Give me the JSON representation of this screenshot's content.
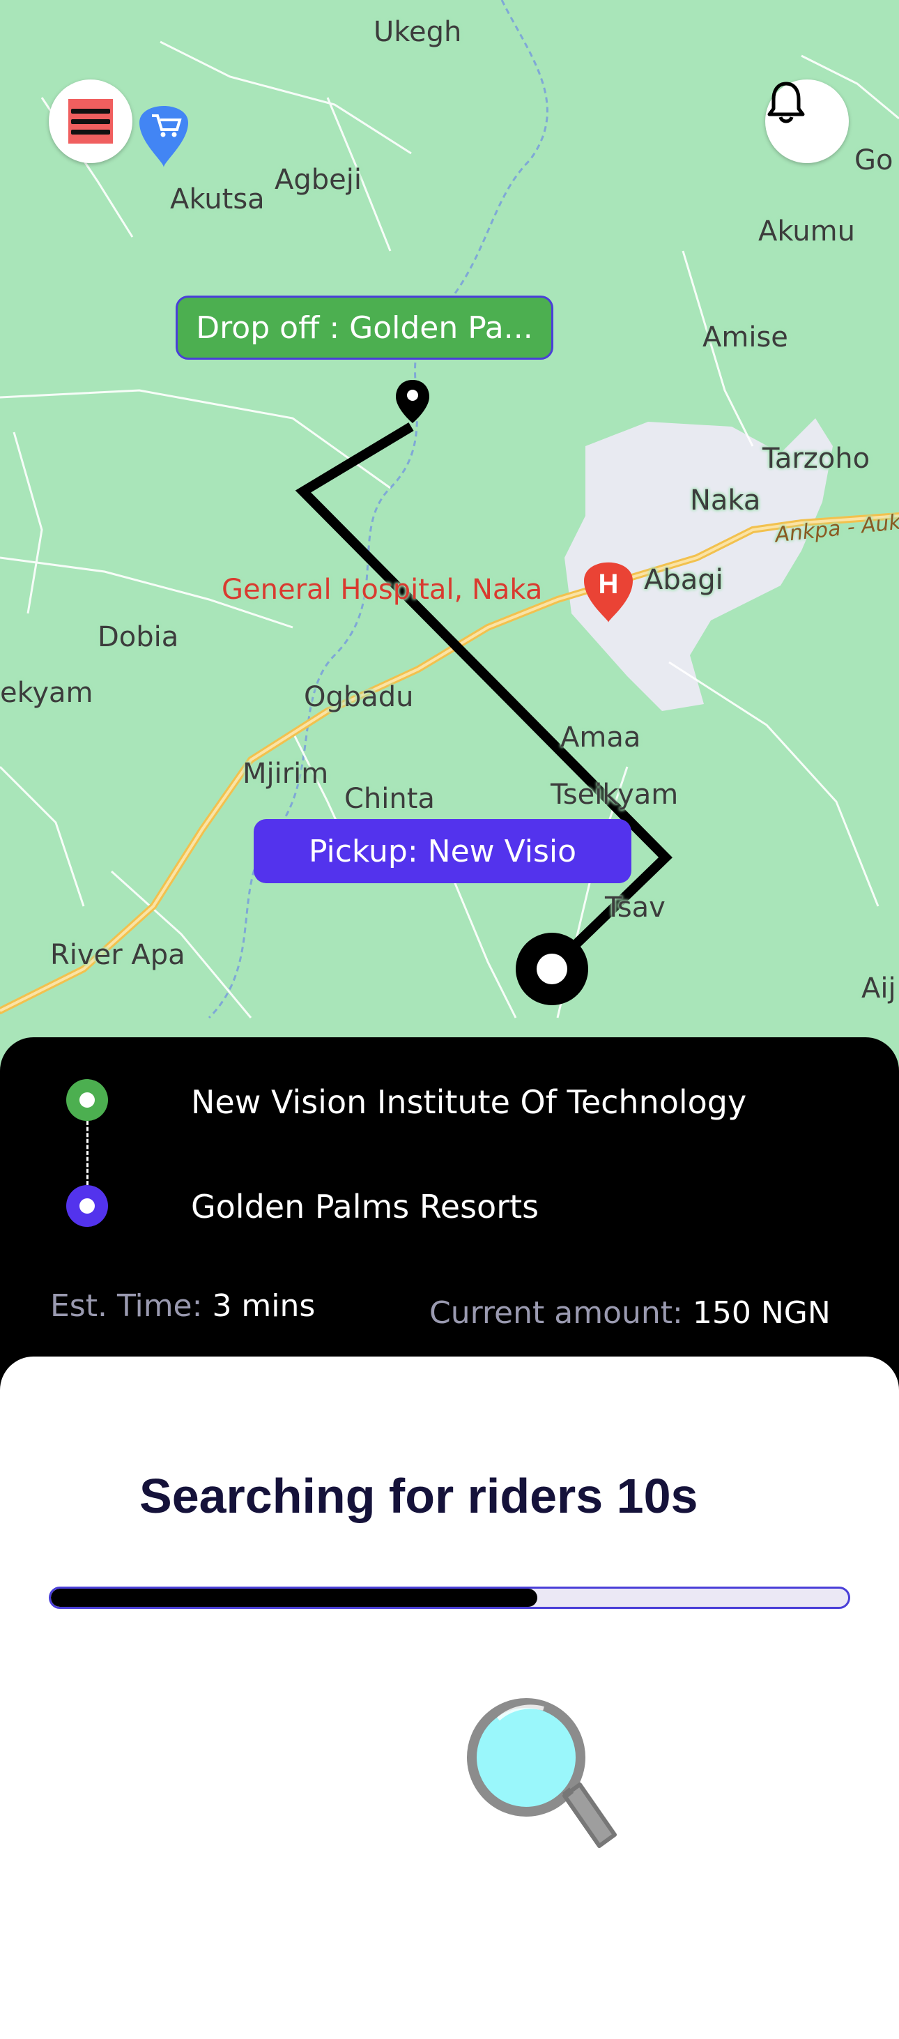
{
  "map": {
    "places": [
      {
        "id": "ukegh",
        "name": "Ukegh"
      },
      {
        "id": "akutsa",
        "name": "Akutsa"
      },
      {
        "id": "agbeji",
        "name": "Agbeji"
      },
      {
        "id": "akumu",
        "name": "Akumu"
      },
      {
        "id": "go",
        "name": "Go"
      },
      {
        "id": "amise",
        "name": "Amise"
      },
      {
        "id": "tarzoho",
        "name": "Tarzoho"
      },
      {
        "id": "naka",
        "name": "Naka"
      },
      {
        "id": "abagi",
        "name": "Abagi"
      },
      {
        "id": "dobia",
        "name": "Dobia"
      },
      {
        "id": "ekyam",
        "name": "ekyam"
      },
      {
        "id": "ogbadu",
        "name": "Ogbadu"
      },
      {
        "id": "amaa",
        "name": "Amaa"
      },
      {
        "id": "mjirim",
        "name": "Mjirim"
      },
      {
        "id": "chinta",
        "name": "Chinta"
      },
      {
        "id": "tseikyam",
        "name": "Tseikyam"
      },
      {
        "id": "tsav",
        "name": "Tsav"
      },
      {
        "id": "riverapa",
        "name": "River Apa"
      },
      {
        "id": "aij",
        "name": "Aij"
      },
      {
        "id": "hospital",
        "name": "General Hospital, Naka"
      },
      {
        "id": "road",
        "name": "Ankpa - Auk"
      }
    ],
    "dropoff_tag": "Drop off : Golden Pa...",
    "pickup_tag": "Pickup: New Visio",
    "menu_icon": "hamburger-menu-icon",
    "bell_icon": "bell-icon",
    "colors": {
      "map_bg": "#a9e5b9",
      "route": "#000000",
      "pickup_tag": "#5333ed",
      "dropoff_tag": "#4caf50",
      "hospital": "#d93a2f"
    }
  },
  "trip": {
    "pickup": "New Vision Institute Of Technology",
    "dropoff": "Golden Palms Resorts",
    "est_time_label": "Est. Time:",
    "est_time_value": "3 mins",
    "amount_label": "Current amount:",
    "amount_value": "150 NGN"
  },
  "search": {
    "title": "Searching for riders 10s",
    "progress": 0.61,
    "icon": "magnifier-icon"
  }
}
